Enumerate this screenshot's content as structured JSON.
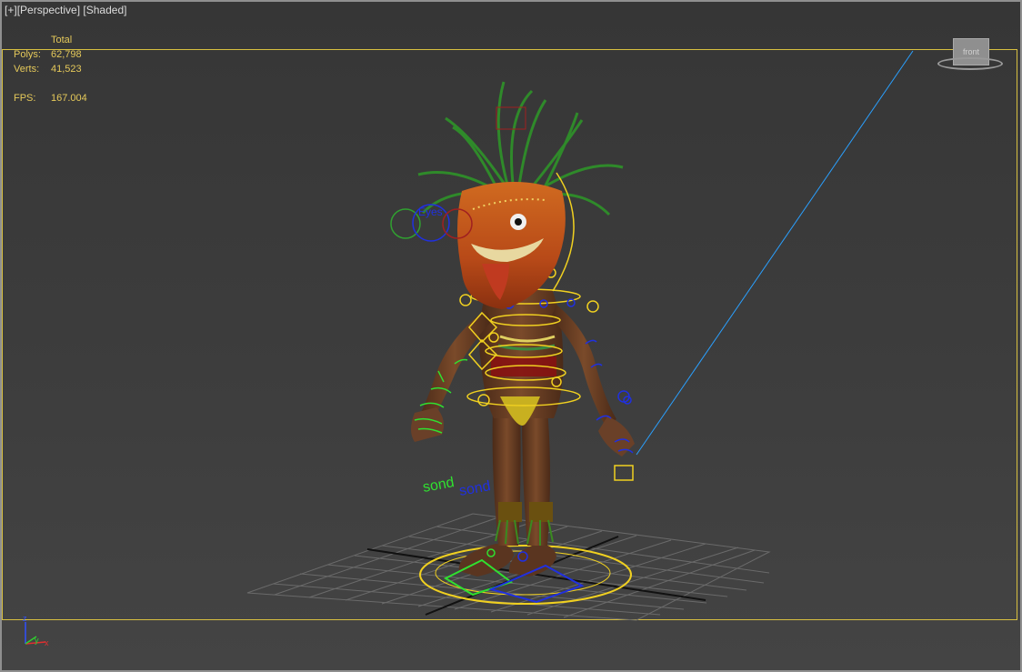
{
  "viewport": {
    "label": {
      "plus": "[+]",
      "view": "[Perspective]",
      "shading": "[Shaded]"
    },
    "stats": {
      "header": "Total",
      "polys_label": "Polys:",
      "polys_value": "62,798",
      "verts_label": "Verts:",
      "verts_value": "41,523",
      "fps_label": "FPS:",
      "fps_value": "167.004"
    },
    "rig_labels": {
      "eyes": "Eyes",
      "left_label": "sond",
      "right_label": "sond"
    },
    "viewcube": {
      "face": "front"
    },
    "axis": {
      "z": "z",
      "y": "y",
      "x": "x"
    }
  },
  "colors": {
    "active_border": "#d8c040",
    "stats_text": "#e5c95a",
    "rig_yellow": "#f0d020",
    "rig_blue": "#2030e0",
    "rig_green": "#30e030",
    "light_line": "#2aa0ff"
  }
}
